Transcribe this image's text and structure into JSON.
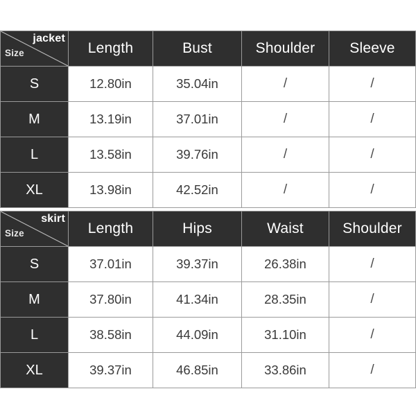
{
  "page": {
    "background_color": "#ffffff",
    "header_color": "#2f2f2f",
    "header_text_color": "#ffffff",
    "cell_text_color": "#3a3a3a",
    "grid_color": "#9a9a9a"
  },
  "tables": [
    {
      "corner": {
        "category": "jacket",
        "size_label": "Size"
      },
      "columns": [
        "Length",
        "Bust",
        "Shoulder",
        "Sleeve"
      ],
      "rows": [
        {
          "size": "S",
          "values": [
            "12.80in",
            "35.04in",
            "/",
            "/"
          ]
        },
        {
          "size": "M",
          "values": [
            "13.19in",
            "37.01in",
            "/",
            "/"
          ]
        },
        {
          "size": "L",
          "values": [
            "13.58in",
            "39.76in",
            "/",
            "/"
          ]
        },
        {
          "size": "XL",
          "values": [
            "13.98in",
            "42.52in",
            "/",
            "/"
          ]
        }
      ]
    },
    {
      "corner": {
        "category": "skirt",
        "size_label": "Size"
      },
      "columns": [
        "Length",
        "Hips",
        "Waist",
        "Shoulder"
      ],
      "rows": [
        {
          "size": "S",
          "values": [
            "37.01in",
            "39.37in",
            "26.38in",
            "/"
          ]
        },
        {
          "size": "M",
          "values": [
            "37.80in",
            "41.34in",
            "28.35in",
            "/"
          ]
        },
        {
          "size": "L",
          "values": [
            "38.58in",
            "44.09in",
            "31.10in",
            "/"
          ]
        },
        {
          "size": "XL",
          "values": [
            "39.37in",
            "46.85in",
            "33.86in",
            "/"
          ]
        }
      ]
    }
  ]
}
